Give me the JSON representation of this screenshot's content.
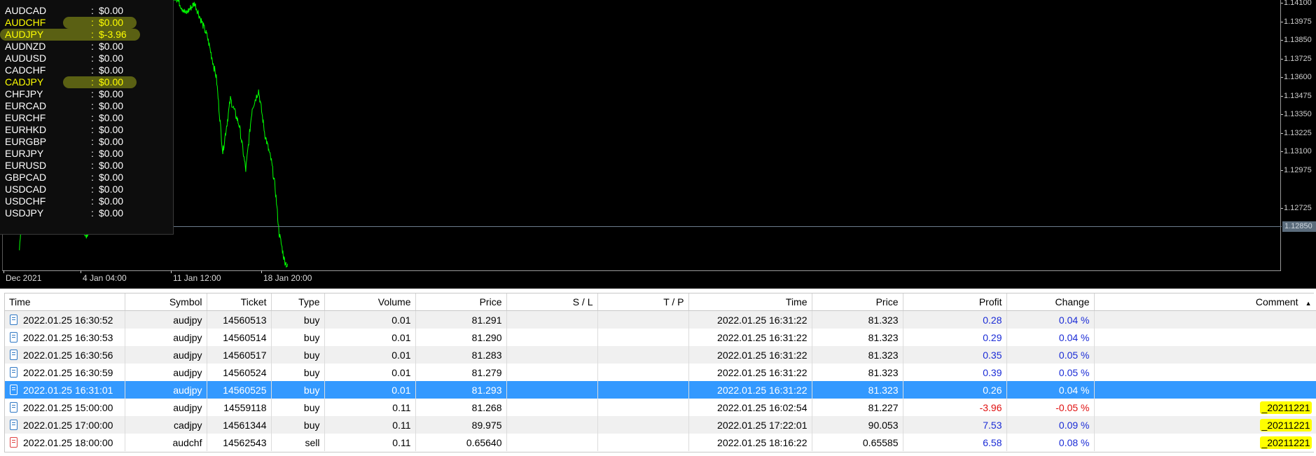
{
  "chart": {
    "y_axis_labels": [
      "1.14100",
      "1.13975",
      "1.13850",
      "1.13725",
      "1.13600",
      "1.13475",
      "1.13350",
      "1.13225",
      "1.13100",
      "1.12975",
      "1.12725"
    ],
    "current_price": "1.12850",
    "x_axis_labels": [
      "Dec 2021",
      "4 Jan 04:00",
      "11 Jan 12:00",
      "18 Jan 20:00"
    ],
    "line_color": "#00ff00",
    "y_range": [
      1.1266,
      1.1415
    ],
    "price_path": [
      [
        0.013,
        1.1275
      ],
      [
        0.015,
        1.13
      ],
      [
        0.02,
        1.1288
      ],
      [
        0.03,
        1.1296
      ],
      [
        0.045,
        1.1292
      ],
      [
        0.06,
        1.129
      ],
      [
        0.066,
        1.1283
      ],
      [
        0.075,
        1.1298
      ],
      [
        0.085,
        1.133
      ],
      [
        0.095,
        1.136
      ],
      [
        0.1,
        1.138
      ],
      [
        0.108,
        1.141
      ],
      [
        0.112,
        1.1392
      ],
      [
        0.118,
        1.1415
      ],
      [
        0.125,
        1.141
      ],
      [
        0.135,
        1.1418
      ],
      [
        0.143,
        1.1408
      ],
      [
        0.15,
        1.1414
      ],
      [
        0.16,
        1.1395
      ],
      [
        0.167,
        1.1372
      ],
      [
        0.172,
        1.133
      ],
      [
        0.178,
        1.136
      ],
      [
        0.185,
        1.1345
      ],
      [
        0.19,
        1.132
      ],
      [
        0.195,
        1.1355
      ],
      [
        0.2,
        1.1365
      ],
      [
        0.205,
        1.134
      ],
      [
        0.21,
        1.1325
      ],
      [
        0.213,
        1.131
      ],
      [
        0.216,
        1.1285
      ],
      [
        0.22,
        1.127
      ],
      [
        0.223,
        1.1265
      ]
    ]
  },
  "symbols_panel": {
    "items": [
      {
        "symbol": "AUDCAD",
        "sep": ":",
        "value": "$0.00",
        "highlight": false
      },
      {
        "symbol": "AUDCHF",
        "sep": ":",
        "value": "$0.00",
        "highlight": true
      },
      {
        "symbol": "AUDJPY",
        "sep": ":",
        "value": "$-3.96",
        "highlight": true
      },
      {
        "symbol": "AUDNZD",
        "sep": ":",
        "value": "$0.00",
        "highlight": false
      },
      {
        "symbol": "AUDUSD",
        "sep": ":",
        "value": "$0.00",
        "highlight": false
      },
      {
        "symbol": "CADCHF",
        "sep": ":",
        "value": "$0.00",
        "highlight": false
      },
      {
        "symbol": "CADJPY",
        "sep": ":",
        "value": "$0.00",
        "highlight": true
      },
      {
        "symbol": "CHFJPY",
        "sep": ":",
        "value": "$0.00",
        "highlight": false
      },
      {
        "symbol": "EURCAD",
        "sep": ":",
        "value": "$0.00",
        "highlight": false
      },
      {
        "symbol": "EURCHF",
        "sep": ":",
        "value": "$0.00",
        "highlight": false
      },
      {
        "symbol": "EURHKD",
        "sep": ":",
        "value": "$0.00",
        "highlight": false
      },
      {
        "symbol": "EURGBP",
        "sep": ":",
        "value": "$0.00",
        "highlight": false
      },
      {
        "symbol": "EURJPY",
        "sep": ":",
        "value": "$0.00",
        "highlight": false
      },
      {
        "symbol": "EURUSD",
        "sep": ":",
        "value": "$0.00",
        "highlight": false
      },
      {
        "symbol": "GBPCAD",
        "sep": ":",
        "value": "$0.00",
        "highlight": false
      },
      {
        "symbol": "USDCAD",
        "sep": ":",
        "value": "$0.00",
        "highlight": false
      },
      {
        "symbol": "USDCHF",
        "sep": ":",
        "value": "$0.00",
        "highlight": false
      },
      {
        "symbol": "USDJPY",
        "sep": ":",
        "value": "$0.00",
        "highlight": false
      }
    ]
  },
  "trades": {
    "columns": [
      "Time",
      "Symbol",
      "Ticket",
      "Type",
      "Volume",
      "Price",
      "S / L",
      "T / P",
      "Time",
      "Price",
      "Profit",
      "Change",
      "Comment"
    ],
    "sort_indicator": "▲",
    "rows": [
      {
        "open_time": "2022.01.25 16:30:52",
        "symbol": "audjpy",
        "ticket": "14560513",
        "type": "buy",
        "volume": "0.01",
        "price": "81.291",
        "sl": "",
        "tp": "",
        "close_time": "2022.01.25 16:31:22",
        "close_price": "81.323",
        "profit": "0.28",
        "change": "0.04 %",
        "comment": "",
        "icon": "document-buy-icon"
      },
      {
        "open_time": "2022.01.25 16:30:53",
        "symbol": "audjpy",
        "ticket": "14560514",
        "type": "buy",
        "volume": "0.01",
        "price": "81.290",
        "sl": "",
        "tp": "",
        "close_time": "2022.01.25 16:31:22",
        "close_price": "81.323",
        "profit": "0.29",
        "change": "0.04 %",
        "comment": "",
        "icon": "document-buy-icon"
      },
      {
        "open_time": "2022.01.25 16:30:56",
        "symbol": "audjpy",
        "ticket": "14560517",
        "type": "buy",
        "volume": "0.01",
        "price": "81.283",
        "sl": "",
        "tp": "",
        "close_time": "2022.01.25 16:31:22",
        "close_price": "81.323",
        "profit": "0.35",
        "change": "0.05 %",
        "comment": "",
        "icon": "document-buy-icon"
      },
      {
        "open_time": "2022.01.25 16:30:59",
        "symbol": "audjpy",
        "ticket": "14560524",
        "type": "buy",
        "volume": "0.01",
        "price": "81.279",
        "sl": "",
        "tp": "",
        "close_time": "2022.01.25 16:31:22",
        "close_price": "81.323",
        "profit": "0.39",
        "change": "0.05 %",
        "comment": "",
        "icon": "document-buy-icon"
      },
      {
        "open_time": "2022.01.25 16:31:01",
        "symbol": "audjpy",
        "ticket": "14560525",
        "type": "buy",
        "volume": "0.01",
        "price": "81.293",
        "sl": "",
        "tp": "",
        "close_time": "2022.01.25 16:31:22",
        "close_price": "81.323",
        "profit": "0.26",
        "change": "0.04 %",
        "comment": "",
        "icon": "document-buy-icon",
        "selected": true
      },
      {
        "open_time": "2022.01.25 15:00:00",
        "symbol": "audjpy",
        "ticket": "14559118",
        "type": "buy",
        "volume": "0.11",
        "price": "81.268",
        "sl": "",
        "tp": "",
        "close_time": "2022.01.25 16:02:54",
        "close_price": "81.227",
        "profit": "-3.96",
        "change": "-0.05 %",
        "comment": "_20211221",
        "icon": "document-buy-icon"
      },
      {
        "open_time": "2022.01.25 17:00:00",
        "symbol": "cadjpy",
        "ticket": "14561344",
        "type": "buy",
        "volume": "0.11",
        "price": "89.975",
        "sl": "",
        "tp": "",
        "close_time": "2022.01.25 17:22:01",
        "close_price": "90.053",
        "profit": "7.53",
        "change": "0.09 %",
        "comment": "_20211221",
        "icon": "document-buy-icon"
      },
      {
        "open_time": "2022.01.25 18:00:00",
        "symbol": "audchf",
        "ticket": "14562543",
        "type": "sell",
        "volume": "0.11",
        "price": "0.65640",
        "sl": "",
        "tp": "",
        "close_time": "2022.01.25 18:16:22",
        "close_price": "0.65585",
        "profit": "6.58",
        "change": "0.08 %",
        "comment": "_20211221",
        "icon": "document-sell-icon"
      }
    ]
  },
  "colors": {
    "selection": "#3399ff",
    "profit_positive": "#1a2bd6",
    "profit_negative": "#e01010",
    "highlight_text": "#ffff00"
  }
}
